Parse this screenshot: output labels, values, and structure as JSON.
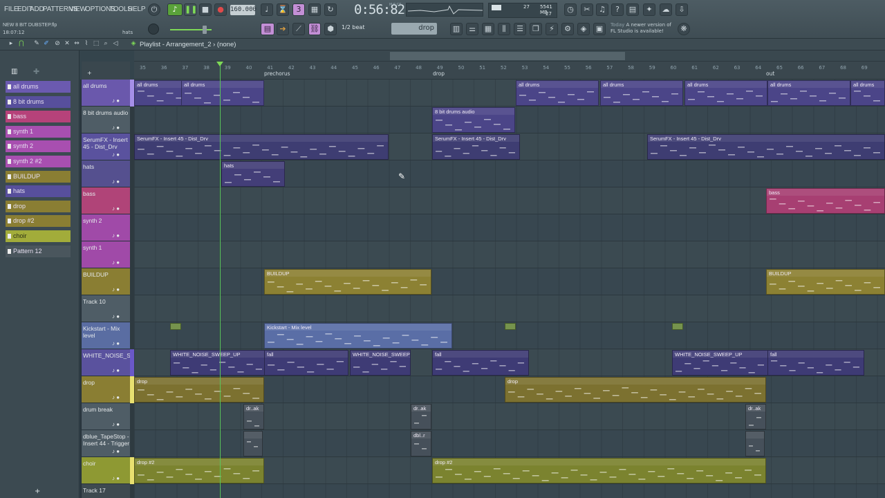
{
  "menu": [
    "FILE",
    "EDIT",
    "ADD",
    "PATTERNS",
    "VIEW",
    "OPTIONS",
    "TOOLS",
    "HELP"
  ],
  "transport": {
    "tempo": "160.000",
    "time": "0:56:82",
    "time_sub": "M:S:CS",
    "cpu": "27",
    "mem": "5541 MB",
    "poly": "27"
  },
  "project": {
    "name": "NEW 8 BIT DUBSTEP.flp",
    "time": "18:07:12",
    "hint": "hats"
  },
  "snap": "1/2 beat",
  "tool_label": "drop",
  "news": {
    "line1": "Today",
    "line2": "A newer version of",
    "line3": "FL Studio is available!"
  },
  "playlist": {
    "title": "Playlist - Arrangement_2 › (none)"
  },
  "ruler": {
    "numbers": [
      "35",
      "36",
      "37",
      "38",
      "39",
      "40",
      "41",
      "42",
      "43",
      "44",
      "45",
      "46",
      "47",
      "48",
      "49",
      "50",
      "51",
      "52",
      "53",
      "54",
      "55",
      "56",
      "57",
      "58",
      "59",
      "60",
      "61",
      "62",
      "63",
      "64",
      "65",
      "66",
      "67",
      "68",
      "69"
    ],
    "markers": [
      {
        "label": "prechorus"
      },
      {
        "label": "drop"
      },
      {
        "label": "out"
      }
    ]
  },
  "patterns": [
    {
      "label": "all drums",
      "color": "#6b5ab0"
    },
    {
      "label": "8 bit drums",
      "color": "#574f9c"
    },
    {
      "label": "bass",
      "color": "#b6427a"
    },
    {
      "label": "synth 1",
      "color": "#a84fb0"
    },
    {
      "label": "synth 2",
      "color": "#a84fb0"
    },
    {
      "label": "synth 2 #2",
      "color": "#a84fb0"
    },
    {
      "label": "BUILDUP",
      "color": "#8a7e33"
    },
    {
      "label": "hats",
      "color": "#574f9c"
    },
    {
      "label": "drop",
      "color": "#8a7e33"
    },
    {
      "label": "drop #2",
      "color": "#8a7e33"
    },
    {
      "label": "choir",
      "color": "#a2ac3a"
    },
    {
      "label": "Pattern 12",
      "color": "#4a565d"
    }
  ],
  "tracks": [
    {
      "name": "all drums",
      "color": "#6a58ac"
    },
    {
      "name": "8 bit drums audio",
      "color": "#4f5d66"
    },
    {
      "name": "SerumFX - Insert 45 - Dist_Drv",
      "color": "#5a529e"
    },
    {
      "name": "hats",
      "color": "#55508f"
    },
    {
      "name": "bass",
      "color": "#b04478"
    },
    {
      "name": "synth 2",
      "color": "#a04aa8"
    },
    {
      "name": "synth 1",
      "color": "#a04aa8"
    },
    {
      "name": "BUILDUP",
      "color": "#8a7e33"
    },
    {
      "name": "Track 10",
      "color": "#4f5d66"
    },
    {
      "name": "Kickstart - Mix level",
      "color": "#5a6da2"
    },
    {
      "name": "WHITE_NOISE_SWEEP_UP",
      "color": "#5a529e"
    },
    {
      "name": "drop",
      "color": "#8a7e33"
    },
    {
      "name": "drum break",
      "color": "#4f5d66"
    },
    {
      "name": "dblue_TapeStop - Insert 44 - Trigger",
      "color": "#4f5d66"
    },
    {
      "name": "choir",
      "color": "#8e9933"
    },
    {
      "name": "Track 17",
      "color": "#3e4a50"
    }
  ],
  "clips": [
    {
      "track": 0,
      "label": "all drums",
      "color": "#4b4588"
    },
    {
      "track": 0,
      "label": "all drums",
      "color": "#4b4588"
    },
    {
      "track": 0,
      "label": "all drums",
      "color": "#4b4588"
    },
    {
      "track": 0,
      "label": "all drums",
      "color": "#4b4588"
    },
    {
      "track": 0,
      "label": "all drums",
      "color": "#4b4588"
    },
    {
      "track": 0,
      "label": "all drums",
      "color": "#4b4588"
    },
    {
      "track": 0,
      "label": "all drums",
      "color": "#4b4588"
    },
    {
      "track": 1,
      "label": "8 bit drums audio",
      "color": "#4b4588"
    },
    {
      "track": 2,
      "label": "SerumFX - Insert 45 - Dist_Drv",
      "color": "#3e3d72"
    },
    {
      "track": 2,
      "label": "SerumFX - Insert 45 - Dist_Drv",
      "color": "#3e3d72"
    },
    {
      "track": 2,
      "label": "SerumFX - Insert 45 - Dist_Drv",
      "color": "#3e3d72"
    },
    {
      "track": 3,
      "label": "hats",
      "color": "#433e78"
    },
    {
      "track": 4,
      "label": "bass",
      "color": "#a73f72"
    },
    {
      "track": 7,
      "label": "BUILDUP",
      "color": "#8c8133"
    },
    {
      "track": 7,
      "label": "BUILDUP",
      "color": "#8c8133"
    },
    {
      "track": 9,
      "label": "",
      "color": "#6b8a3e"
    },
    {
      "track": 9,
      "label": "Kickstart - Mix level",
      "color": "#5a6ea6"
    },
    {
      "track": 9,
      "label": "",
      "color": "#6b8a3e"
    },
    {
      "track": 9,
      "label": "",
      "color": "#6b8a3e"
    },
    {
      "track": 10,
      "label": "WHITE_NOISE_SWEEP_UP",
      "color": "#3e3b75"
    },
    {
      "track": 10,
      "label": "fall",
      "color": "#3e3b75"
    },
    {
      "track": 10,
      "label": "WHITE_NOISE_SWEEP_UP",
      "color": "#3e3b75"
    },
    {
      "track": 10,
      "label": "fall",
      "color": "#3e3b75"
    },
    {
      "track": 10,
      "label": "WHITE_NOISE_SWEEP_UP",
      "color": "#3e3b75"
    },
    {
      "track": 10,
      "label": "fall",
      "color": "#3e3b75"
    },
    {
      "track": 11,
      "label": "drop",
      "color": "#7c7130"
    },
    {
      "track": 11,
      "label": "drop",
      "color": "#7c7130"
    },
    {
      "track": 12,
      "label": "dr..ak",
      "color": "#46505a"
    },
    {
      "track": 12,
      "label": "dr..ak",
      "color": "#46505a"
    },
    {
      "track": 12,
      "label": "dr..ak",
      "color": "#46505a"
    },
    {
      "track": 13,
      "label": "",
      "color": "#46505a"
    },
    {
      "track": 13,
      "label": "dbl..r",
      "color": "#46505a"
    },
    {
      "track": 13,
      "label": "",
      "color": "#46505a"
    },
    {
      "track": 14,
      "label": "drop #2",
      "color": "#7b832f"
    },
    {
      "track": 14,
      "label": "drop #2",
      "color": "#7b832f"
    }
  ]
}
